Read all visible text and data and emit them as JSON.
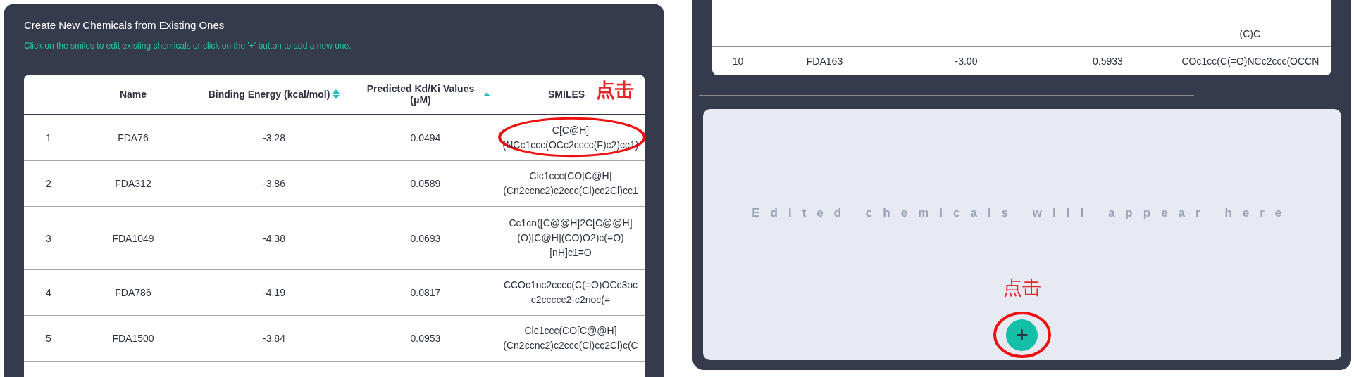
{
  "left_panel": {
    "title": "Create New Chemicals from Existing Ones",
    "subtitle": "Click on the smiles to edit existing chemicals or click on the '+' button to add a new one.",
    "table": {
      "columns": [
        {
          "label": "Name"
        },
        {
          "label": "Binding Energy (kcal/mol)",
          "sorted_ascending": false
        },
        {
          "label": "Predicted Kd/Ki Values (μM)",
          "sorted_ascending": true
        },
        {
          "label": "SMILES",
          "annotation": "点击"
        }
      ],
      "rows": [
        {
          "index": "1",
          "name": "FDA76",
          "binding_energy": "-3.28",
          "kd_ki": "0.0494",
          "smiles": [
            "C[C@H]",
            "(NCc1ccc(OCc2cccc(F)c2)cc1)"
          ],
          "highlighted": true
        },
        {
          "index": "2",
          "name": "FDA312",
          "binding_energy": "-3.86",
          "kd_ki": "0.0589",
          "smiles": [
            "Clc1ccc(CO[C@H]",
            "(Cn2ccnc2)c2ccc(Cl)cc2Cl)cc1"
          ],
          "highlighted": false
        },
        {
          "index": "3",
          "name": "FDA1049",
          "binding_energy": "-4.38",
          "kd_ki": "0.0693",
          "smiles": [
            "Cc1cn([C@@H]2C[C@@H]",
            "(O)[C@H](CO)O2)c(=O)",
            "[nH]c1=O"
          ],
          "highlighted": false
        },
        {
          "index": "4",
          "name": "FDA786",
          "binding_energy": "-4.19",
          "kd_ki": "0.0817",
          "smiles": [
            "CCOc1nc2cccc(C(=O)OCc3oc",
            "c2ccccc2-c2noc(="
          ],
          "highlighted": false
        },
        {
          "index": "5",
          "name": "FDA1500",
          "binding_energy": "-3.84",
          "kd_ki": "0.0953",
          "smiles": [
            "Clc1ccc(CO[C@@H]",
            "(Cn2ccnc2)c2ccc(Cl)cc2Cl)c(C"
          ],
          "highlighted": false
        }
      ]
    }
  },
  "right_panel": {
    "table": {
      "rows": [
        {
          "smiles": [
            "(C)C"
          ]
        },
        {
          "index": "10",
          "name": "FDA163",
          "binding_energy": "-3.00",
          "kd_ki": "0.5933",
          "smiles": [
            "COc1cc(C(=O)NCc2ccc(OCCN"
          ]
        }
      ]
    },
    "empty_message": "Edited chemicals will appear here",
    "add_button": {
      "label": "+",
      "annotation": "点击"
    }
  }
}
